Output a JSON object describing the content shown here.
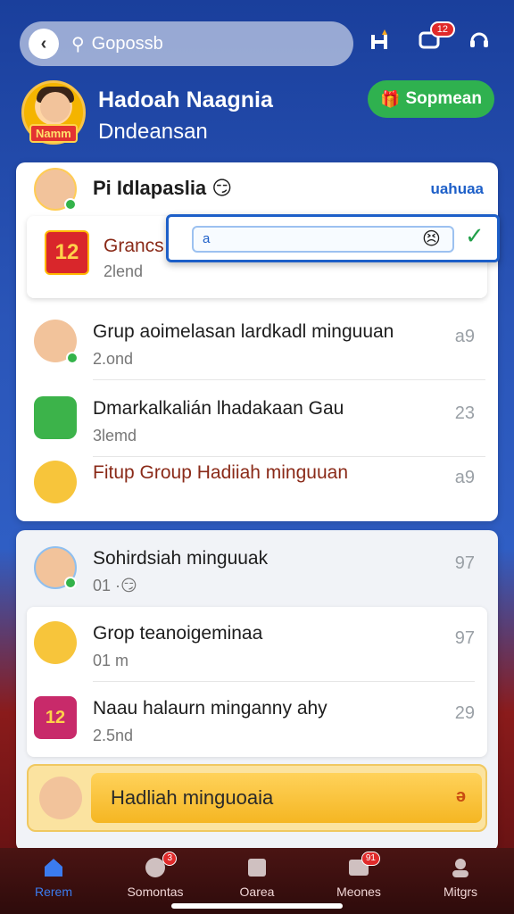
{
  "search": {
    "placeholder": "Gopossb"
  },
  "top_icons": {
    "chat_badge": "12"
  },
  "profile": {
    "name": "Hadoah Naagnia",
    "subtitle": "Dndeansan",
    "ribbon": "Namm"
  },
  "gift_button": {
    "label": "Sopmean"
  },
  "card1": {
    "header": {
      "title": "Pi Idlapaslia",
      "emoji": "😏",
      "link": "uahuaa"
    },
    "subcard": {
      "title": "Grancs",
      "subtitle": "2lend",
      "gift_number": "12",
      "popup_input": "a"
    },
    "rows": [
      {
        "title": "Grup aoimelasan lardkadl minguuan",
        "subtitle": "2.ond",
        "count": "a9"
      },
      {
        "title": "Dmarkalkalián lhadakaan Gau",
        "subtitle": "3lemd",
        "count": "23"
      },
      {
        "title": "Fitup Group Hadiiah minguuan",
        "subtitle": "",
        "count": "a9"
      }
    ]
  },
  "card2": {
    "rows": [
      {
        "title": "Sohirdsiah minguuak",
        "subtitle": "01 ·😏",
        "count": "97"
      },
      {
        "title": "Grop teanoigeminaa",
        "subtitle": "01 m",
        "count": "97"
      },
      {
        "title": "Naau halaurn minganny ahy",
        "subtitle": "2.5nd",
        "count": "29"
      }
    ],
    "gift_number": "12",
    "cta": {
      "label": "Hadliah minguoaia",
      "arrow": "ə"
    }
  },
  "bottom_nav": [
    {
      "label": "Rerem",
      "icon": "home-icon",
      "badge": ""
    },
    {
      "label": "Somontas",
      "icon": "chat-icon",
      "badge": "3"
    },
    {
      "label": "Oarea",
      "icon": "map-icon",
      "badge": ""
    },
    {
      "label": "Meones",
      "icon": "messages-icon",
      "badge": "91"
    },
    {
      "label": "Mitgrs",
      "icon": "person-icon",
      "badge": ""
    }
  ],
  "colors": {
    "accent": "#1d5fc8",
    "green": "#2fb14f",
    "nav_active": "#3b7cf0",
    "header_blue": "#1a3f9c"
  }
}
